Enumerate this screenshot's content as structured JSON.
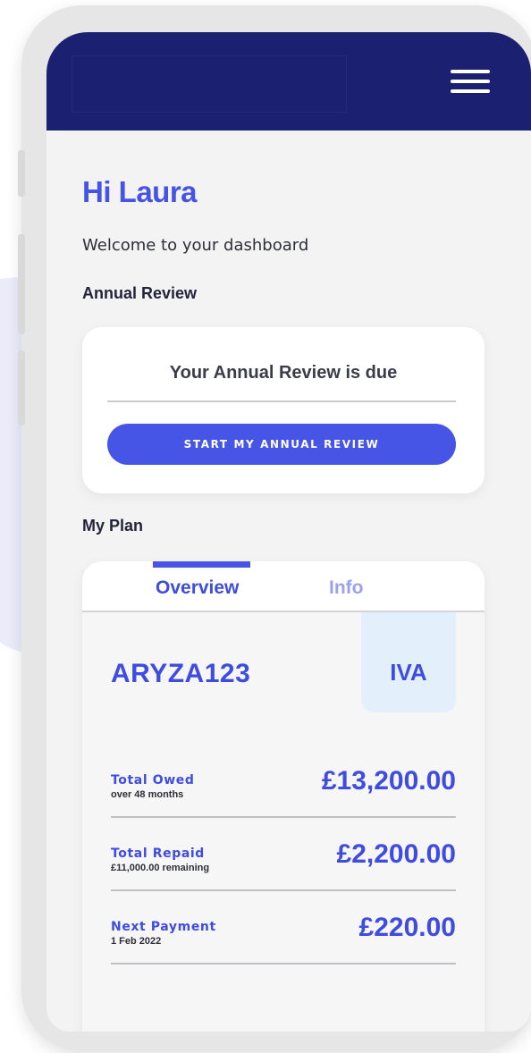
{
  "greeting": "Hi Laura",
  "welcome": "Welcome to your dashboard",
  "annual_review": {
    "section_title": "Annual Review",
    "message": "Your Annual Review is due",
    "button_label": "START MY ANNUAL REVIEW"
  },
  "plan": {
    "section_title": "My Plan",
    "tabs": [
      {
        "label": "Overview",
        "active": true
      },
      {
        "label": "Info",
        "active": false
      }
    ],
    "reference": "ARYZA123",
    "type": "IVA",
    "stats": [
      {
        "label": "Total Owed",
        "sub": "over 48 months",
        "value": "£13,200.00"
      },
      {
        "label": "Total Repaid",
        "sub": "£11,000.00 remaining",
        "value": "£2,200.00"
      },
      {
        "label": "Next Payment",
        "sub": "1 Feb 2022",
        "value": "£220.00"
      }
    ]
  },
  "icons": {
    "menu": "hamburger-menu-icon"
  },
  "colors": {
    "header": "#1b2070",
    "accent": "#4653e5",
    "plan_type_bg": "#e3f0fb",
    "screen_bg": "#f3f3f3"
  }
}
